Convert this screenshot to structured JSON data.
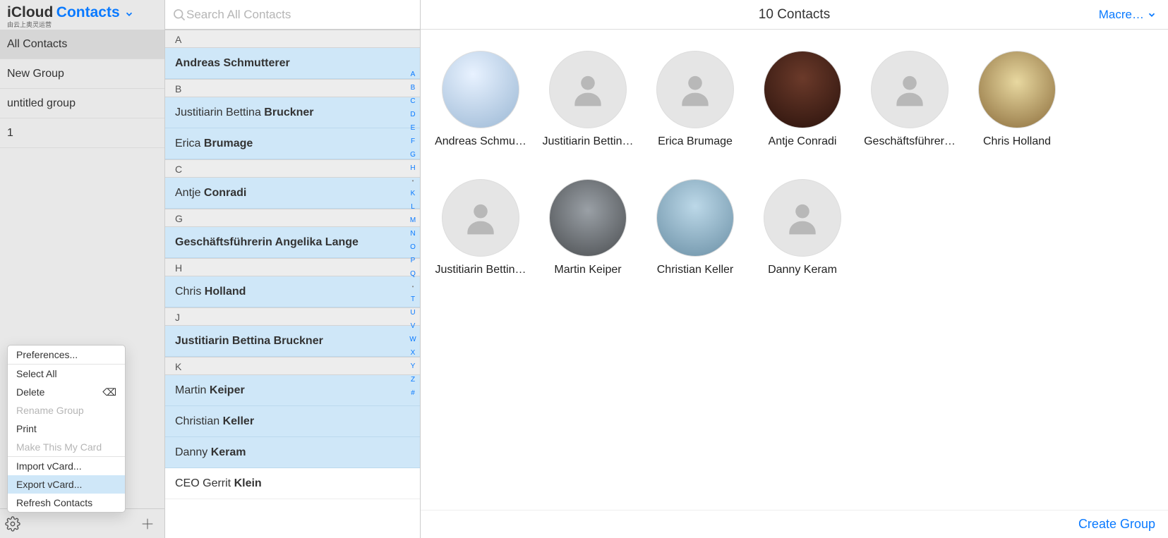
{
  "brand": {
    "icloud": "iCloud",
    "app": "Contacts",
    "sub": "由云上奥灵运营"
  },
  "sidebar": {
    "items": [
      "All Contacts",
      "New Group",
      "untitled group",
      "1"
    ],
    "selected_index": 0
  },
  "search": {
    "placeholder": "Search All Contacts",
    "value": ""
  },
  "alpha_index": [
    "A",
    "B",
    "C",
    "D",
    "E",
    "F",
    "G",
    "H",
    "•",
    "K",
    "L",
    "M",
    "N",
    "O",
    "P",
    "Q",
    "•",
    "T",
    "U",
    "V",
    "W",
    "X",
    "Y",
    "Z",
    "#"
  ],
  "list_sections": [
    {
      "letter": "A",
      "rows": [
        {
          "first": "Andreas",
          "last": "Schmutterer",
          "bold_all": true
        }
      ]
    },
    {
      "letter": "B",
      "rows": [
        {
          "first": "Justitiarin Bettina",
          "last": "Bruckner"
        },
        {
          "first": "Erica",
          "last": "Brumage"
        }
      ]
    },
    {
      "letter": "C",
      "rows": [
        {
          "first": "Antje",
          "last": "Conradi"
        }
      ]
    },
    {
      "letter": "G",
      "rows": [
        {
          "first": "Geschäftsführerin Angelika",
          "last": "Lange",
          "bold_all": true
        }
      ]
    },
    {
      "letter": "H",
      "rows": [
        {
          "first": "Chris",
          "last": "Holland"
        }
      ]
    },
    {
      "letter": "J",
      "rows": [
        {
          "first": "Justitiarin Bettina Bruckner",
          "last": "",
          "bold_all": true
        }
      ]
    },
    {
      "letter": "K",
      "rows": [
        {
          "first": "Martin",
          "last": "Keiper"
        },
        {
          "first": "Christian",
          "last": "Keller"
        },
        {
          "first": "Danny",
          "last": "Keram"
        },
        {
          "first": "CEO Gerrit",
          "last": "Klein",
          "plain": true
        }
      ]
    }
  ],
  "main": {
    "count_label": "10 Contacts",
    "sort": "Macre…",
    "create_group": "Create Group",
    "cards": [
      {
        "name": "Andreas Schmu…",
        "avatar": "photo",
        "cls": "av1"
      },
      {
        "name": "Justitiarin Bettin…",
        "avatar": "placeholder"
      },
      {
        "name": "Erica Brumage",
        "avatar": "placeholder"
      },
      {
        "name": "Antje Conradi",
        "avatar": "photo",
        "cls": "av4"
      },
      {
        "name": "Geschäftsführer…",
        "avatar": "placeholder"
      },
      {
        "name": "Chris Holland",
        "avatar": "photo",
        "cls": "av6"
      },
      {
        "name": "Justitiarin Bettin…",
        "avatar": "placeholder"
      },
      {
        "name": "Martin Keiper",
        "avatar": "photo",
        "cls": "av8"
      },
      {
        "name": "Christian Keller",
        "avatar": "photo",
        "cls": "av9"
      },
      {
        "name": "Danny Keram",
        "avatar": "placeholder"
      }
    ]
  },
  "menu": {
    "items": [
      {
        "label": "Preferences...",
        "enabled": true
      },
      {
        "sep": true
      },
      {
        "label": "Select All",
        "enabled": true
      },
      {
        "label": "Delete",
        "enabled": true,
        "kbd": "⌫"
      },
      {
        "label": "Rename Group",
        "enabled": false
      },
      {
        "label": "Print",
        "enabled": true
      },
      {
        "label": "Make This My Card",
        "enabled": false
      },
      {
        "sep": true
      },
      {
        "label": "Import vCard...",
        "enabled": true
      },
      {
        "label": "Export vCard...",
        "enabled": true,
        "highlight": true
      },
      {
        "label": "Refresh Contacts",
        "enabled": true
      }
    ]
  },
  "icons": {
    "search": "search-icon",
    "gear": "gear-icon",
    "plus": "plus-icon",
    "chevron": "chevron-down-icon",
    "person": "person-placeholder-icon",
    "backspace": "backspace-icon"
  }
}
